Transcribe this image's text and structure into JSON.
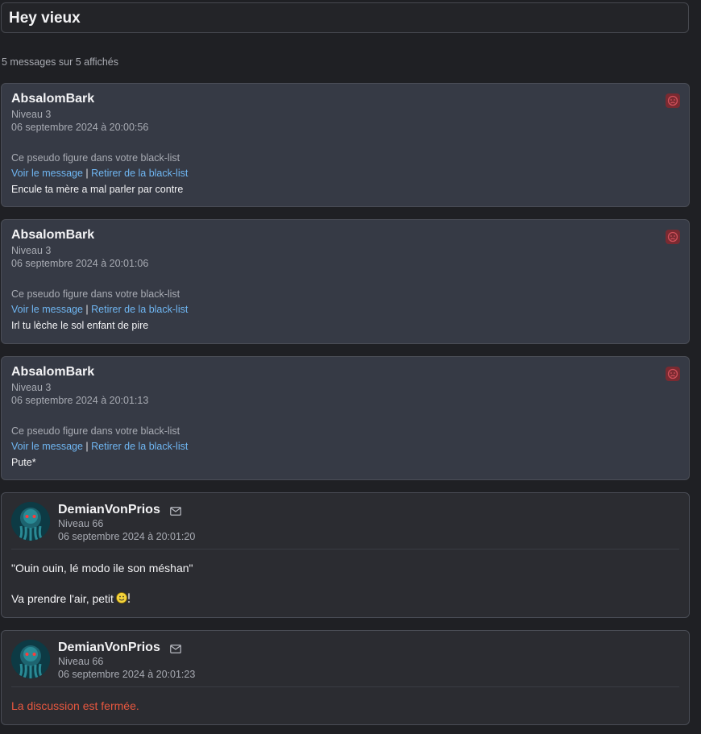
{
  "topic": {
    "title": "Hey vieux"
  },
  "count_text": "5 messages sur 5 affichés",
  "blacklist": {
    "note": "Ce pseudo figure dans votre black-list",
    "view_label": "Voir le message",
    "separator": " | ",
    "remove_label": "Retirer de la black-list"
  },
  "posts": [
    {
      "author": "AbsalomBark",
      "level": "Niveau 3",
      "date": "06 septembre 2024 à 20:00:56",
      "text": "Encule ta mère a mal parler par contre"
    },
    {
      "author": "AbsalomBark",
      "level": "Niveau 3",
      "date": "06 septembre 2024 à 20:01:06",
      "text": "Irl tu lèche le sol enfant de pire"
    },
    {
      "author": "AbsalomBark",
      "level": "Niveau 3",
      "date": "06 septembre 2024 à 20:01:13",
      "text": "Pute*"
    },
    {
      "author": "DemianVonPrios",
      "level": "Niveau 66",
      "date": "06 septembre 2024 à 20:01:20",
      "line1": "\"Ouin ouin, lé modo ile son méshan\"",
      "line2": "Va prendre l'air, petit"
    },
    {
      "author": "DemianVonPrios",
      "level": "Niveau 66",
      "date": "06 septembre 2024 à 20:01:23",
      "closed": "La discussion est fermée."
    }
  ],
  "colors": {
    "link": "#6fb6f2",
    "closed": "#e8573f",
    "sad_badge": "#7a2a31"
  },
  "icons": {
    "blacklist": "sad-face-icon",
    "mail": "envelope-icon",
    "smiley": "smiley-icon"
  }
}
